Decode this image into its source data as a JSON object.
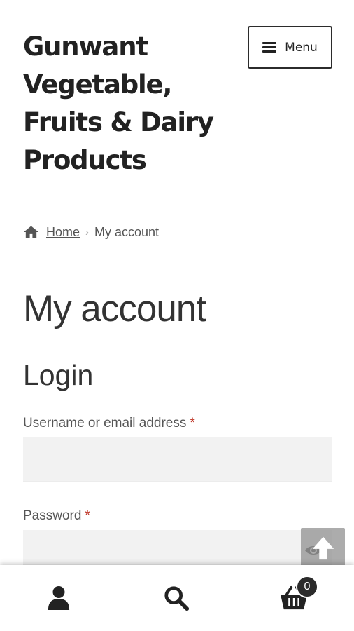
{
  "header": {
    "site_title": "Gunwant Vegetable, Fruits & Dairy Products",
    "menu_label": "Menu"
  },
  "breadcrumb": {
    "home_label": "Home",
    "separator": "›",
    "current": "My account"
  },
  "page": {
    "title": "My account",
    "section": "Login"
  },
  "form": {
    "username_label": "Username or email address",
    "password_label": "Password",
    "required_marker": "*",
    "username_value": "",
    "password_value": ""
  },
  "bottom_bar": {
    "cart_count": "0"
  },
  "icons": {
    "home": "home-icon",
    "menu": "hamburger-icon",
    "eye": "eye-icon",
    "scroll_top": "arrow-up-icon",
    "account": "user-icon",
    "search": "search-icon",
    "cart": "cart-icon"
  },
  "colors": {
    "required": "#c0392b",
    "text_dark": "#222222",
    "input_bg": "#f2f2f2"
  }
}
